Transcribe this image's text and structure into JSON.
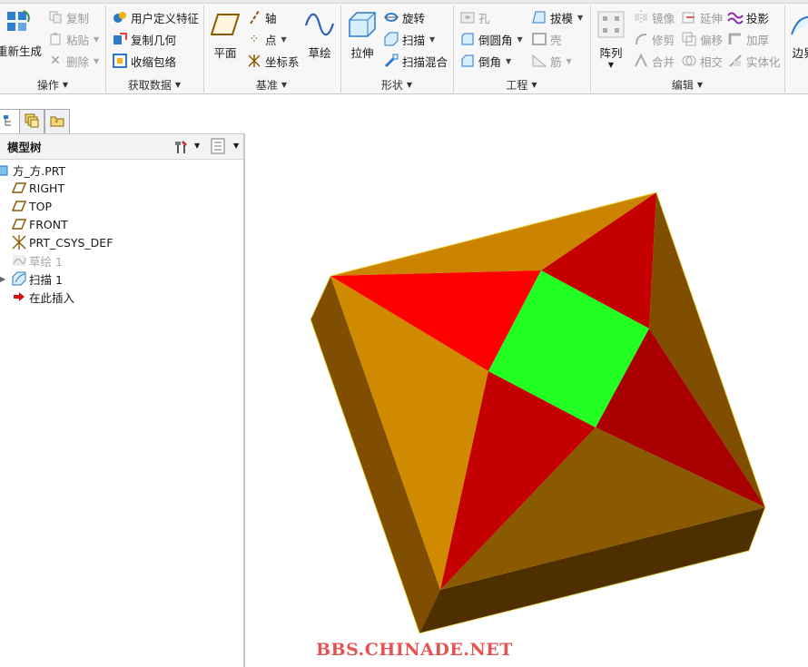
{
  "ribbon": {
    "operations": {
      "group_label": "操作",
      "regenerate": "重新生成",
      "copy": "复制",
      "paste": "粘贴",
      "delete": "删除"
    },
    "get_data": {
      "group_label": "获取数据",
      "user_defined_feature": "用户定义特征",
      "copy_geometry": "复制几何",
      "shrinkwrap": "收缩包络"
    },
    "datum": {
      "group_label": "基准",
      "plane": "平面",
      "axis": "轴",
      "point": "点",
      "csys": "坐标系",
      "sketch": "草绘"
    },
    "shapes": {
      "group_label": "形状",
      "extrude": "拉伸",
      "revolve": "旋转",
      "sweep": "扫描",
      "swept_blend": "扫描混合"
    },
    "engineering": {
      "group_label": "工程",
      "hole": "孔",
      "round": "倒圆角",
      "chamfer": "倒角",
      "draft": "拔模",
      "shell": "壳",
      "rib": "筋"
    },
    "editing": {
      "group_label": "编辑",
      "pattern": "阵列",
      "mirror": "镜像",
      "trim": "修剪",
      "merge": "合并",
      "extend": "延伸",
      "offset": "偏移",
      "intersect": "相交",
      "project": "投影",
      "thicken": "加厚",
      "solidify": "实体化"
    },
    "partial_next": "边界"
  },
  "model_tree": {
    "title": "模型树",
    "items": [
      {
        "label": "方_方.PRT",
        "icon": "part-icon",
        "enabled": true
      },
      {
        "label": "RIGHT",
        "icon": "datum-plane-icon",
        "enabled": true
      },
      {
        "label": "TOP",
        "icon": "datum-plane-icon",
        "enabled": true
      },
      {
        "label": "FRONT",
        "icon": "datum-plane-icon",
        "enabled": true
      },
      {
        "label": "PRT_CSYS_DEF",
        "icon": "csys-icon",
        "enabled": true
      },
      {
        "label": "草绘 1",
        "icon": "sketch-icon",
        "enabled": false
      },
      {
        "label": "扫描 1",
        "icon": "sweep-icon",
        "enabled": true
      },
      {
        "label": "在此插入",
        "icon": "insert-here-arrow-icon",
        "enabled": true
      }
    ]
  },
  "viewport": {
    "model": "pyramid-frustum-solid",
    "colors": {
      "side_light": "#d08a00",
      "side_dark": "#7f4e00",
      "side_darkest": "#4e2f00",
      "top_orange": "#cc8400",
      "top_brown": "#8a5a00",
      "red": "#ff0000",
      "red_dark": "#c40000",
      "red_darker": "#a80000",
      "green": "#22ff22"
    },
    "watermark": "BBS.CHINADE.NET"
  }
}
